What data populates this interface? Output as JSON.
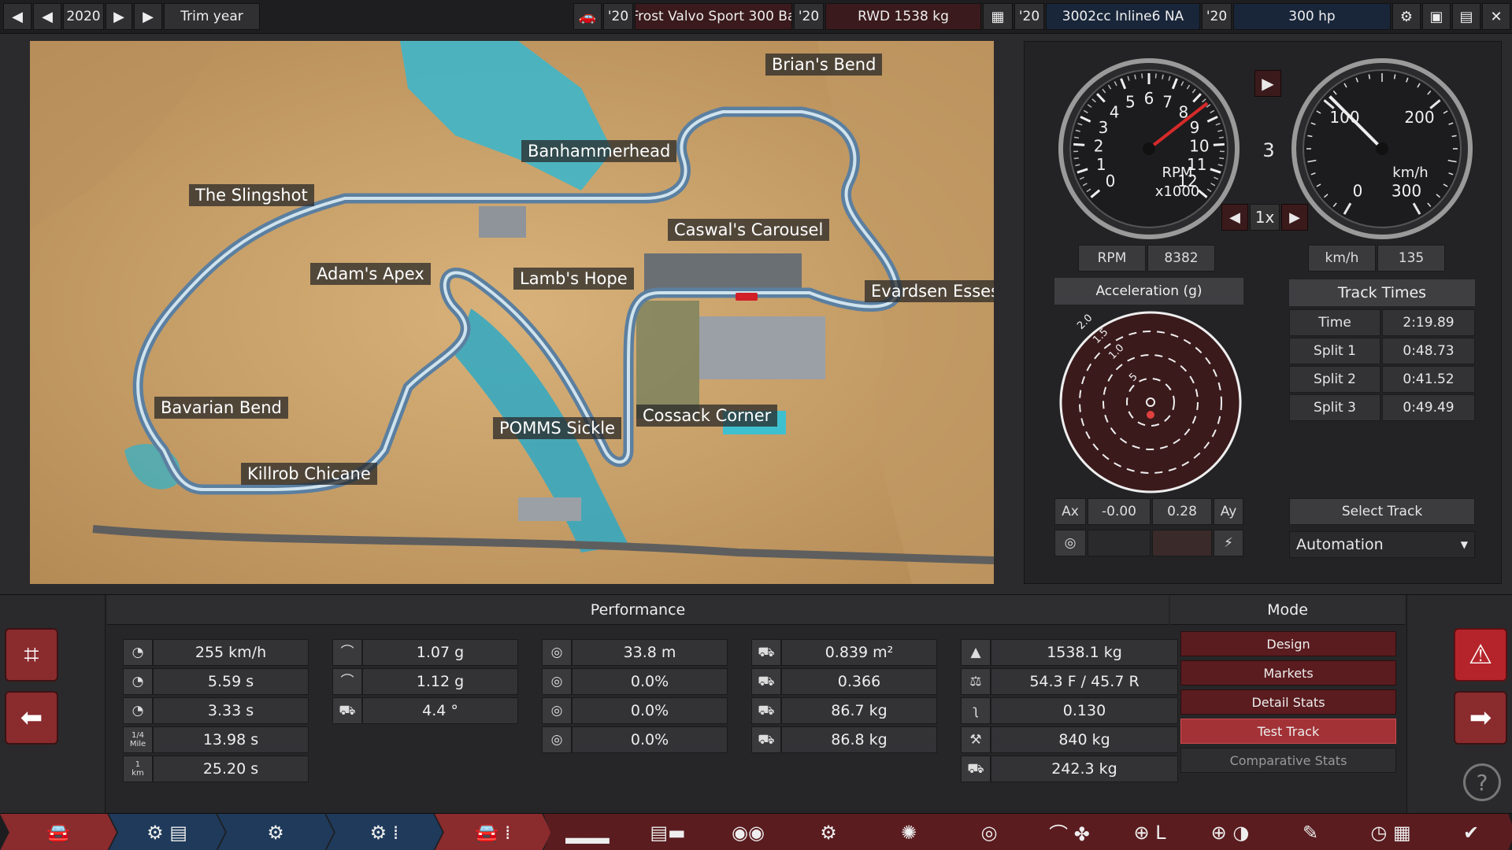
{
  "topbar": {
    "year": "2020",
    "trim_label": "Trim year",
    "car_year": "'20",
    "car_name": "Frost Valvo Sport 300 Ba",
    "chassis_year": "'20",
    "chassis": "RWD 1538 kg",
    "engine_year": "'20",
    "engine": "3002cc Inline6 NA",
    "power_year": "'20",
    "power": "300 hp"
  },
  "map": {
    "corners": [
      "Brian's Bend",
      "Banhammerhead",
      "The Slingshot",
      "Caswal's Carousel",
      "Adam's Apex",
      "Lamb's Hope",
      "Evardsen Esses",
      "Bavarian Bend",
      "Cossack Corner",
      "POMMS Sickle",
      "Killrob Chicane"
    ]
  },
  "gauges": {
    "gear": "3",
    "speed_mult": "1x",
    "rpm_label": "RPM",
    "rpm_value": "8382",
    "rpm_dial_label": "RPM",
    "rpm_dial_unit": "x1000",
    "rpm_ticks": [
      "0",
      "1",
      "2",
      "3",
      "4",
      "5",
      "6",
      "7",
      "8",
      "9",
      "10",
      "11",
      "12"
    ],
    "speed_label": "km/h",
    "speed_value": "135",
    "speed_dial_unit": "km/h",
    "speed_ticks": [
      "0",
      "100",
      "200",
      "300"
    ],
    "accel_title": "Acceleration (g)",
    "accel_rings": [
      "2.0",
      "1.5",
      "1.0",
      "5"
    ],
    "ax_label": "Ax",
    "ax_value": "-0.00",
    "ay_value": "0.28",
    "ay_label": "Ay",
    "rpm_needle_fraction": 0.7,
    "speed_needle_fraction": 0.35
  },
  "track_times": {
    "title": "Track Times",
    "rows": [
      {
        "label": "Time",
        "value": "2:19.89"
      },
      {
        "label": "Split 1",
        "value": "0:48.73"
      },
      {
        "label": "Split 2",
        "value": "0:41.52"
      },
      {
        "label": "Split 3",
        "value": "0:49.49"
      }
    ],
    "select_track": "Select Track",
    "track_selected": "Automation"
  },
  "performance": {
    "title": "Performance",
    "col1": [
      {
        "icon": "top-speed-icon",
        "glyph": "◔",
        "value": "255 km/h"
      },
      {
        "icon": "accel-0-100-icon",
        "glyph": "◔",
        "value": "5.59 s"
      },
      {
        "icon": "accel-80-120-icon",
        "glyph": "◔",
        "value": "3.33 s"
      },
      {
        "icon": "quarter-mile-icon",
        "glyph": "1/4\nMile",
        "value": "13.98 s"
      },
      {
        "icon": "one-km-icon",
        "glyph": "1\nkm",
        "value": "25.20 s"
      }
    ],
    "col2": [
      {
        "icon": "cornering-icon",
        "glyph": "⌒",
        "value": "1.07 g"
      },
      {
        "icon": "cornering-high-icon",
        "glyph": "⌒",
        "value": "1.12 g"
      },
      {
        "icon": "body-roll-icon",
        "glyph": "⛟",
        "value": "4.4 °"
      }
    ],
    "col3": [
      {
        "icon": "braking-distance-icon",
        "glyph": "◎",
        "value": "33.8 m"
      },
      {
        "icon": "brake-fade-icon",
        "glyph": "◎",
        "value": "0.0%"
      },
      {
        "icon": "brake-wheel-lock-icon",
        "glyph": "◎",
        "value": "0.0%"
      },
      {
        "icon": "brake-wheel-icon",
        "glyph": "◎",
        "value": "0.0%"
      }
    ],
    "col4": [
      {
        "icon": "frontal-area-icon",
        "glyph": "⛟",
        "value": "0.839 m²"
      },
      {
        "icon": "drag-coefficient-icon",
        "glyph": "⛟",
        "value": "0.366"
      },
      {
        "icon": "front-downforce-icon",
        "glyph": "⛟",
        "value": "86.7 kg"
      },
      {
        "icon": "rear-downforce-icon",
        "glyph": "⛟",
        "value": "86.8 kg"
      }
    ],
    "col5": [
      {
        "icon": "weight-icon",
        "glyph": "▲",
        "value": "1538.1 kg"
      },
      {
        "icon": "weight-distribution-icon",
        "glyph": "⚖",
        "value": "54.3 F / 45.7 R"
      },
      {
        "icon": "aero-icon",
        "glyph": "ʅ",
        "value": "0.130"
      },
      {
        "icon": "tow-weight-icon",
        "glyph": "⚒",
        "value": "840 kg"
      },
      {
        "icon": "cargo-icon",
        "glyph": "⛟",
        "value": "242.3 kg"
      }
    ]
  },
  "mode": {
    "title": "Mode",
    "buttons": [
      "Design",
      "Markets",
      "Detail Stats",
      "Test Track",
      "Comparative Stats"
    ]
  },
  "colors": {
    "accent_red": "#8a2b2e",
    "active_red": "#a23236",
    "blue_field": "#19263a",
    "alert_red": "#b5242a"
  }
}
